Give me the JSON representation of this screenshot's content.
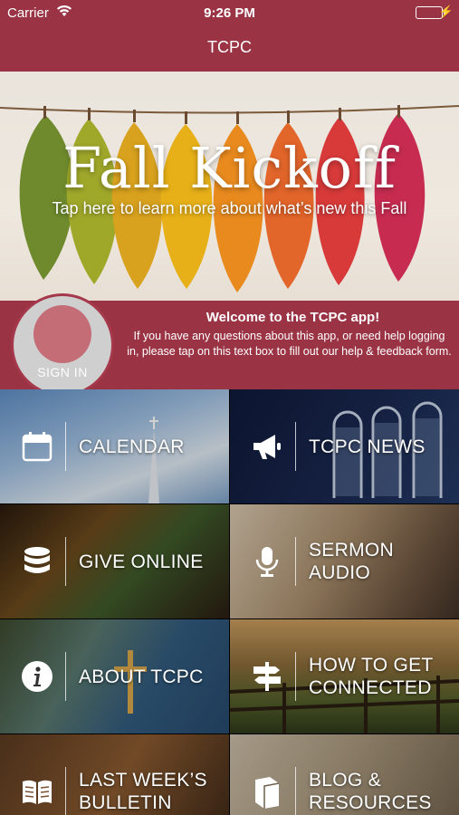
{
  "status_bar": {
    "carrier": "Carrier",
    "time": "9:26 PM"
  },
  "nav": {
    "title": "TCPC"
  },
  "banner": {
    "headline": "Fall Kickoff",
    "subtitle": "Tap here to learn more about what’s new this Fall"
  },
  "welcome": {
    "sign_in": "SIGN IN",
    "title": "Welcome to the TCPC app!",
    "body": "If you have any questions about this app, or need help logging in, please tap on this text box to fill out our help & feedback form."
  },
  "tiles": [
    {
      "label": "CALENDAR",
      "icon": "calendar-icon"
    },
    {
      "label": "TCPC NEWS",
      "icon": "megaphone-icon"
    },
    {
      "label": "GIVE ONLINE",
      "icon": "database-icon"
    },
    {
      "label_line1": "SERMON",
      "label_line2": "AUDIO",
      "icon": "microphone-icon"
    },
    {
      "label": "ABOUT TCPC",
      "icon": "info-icon"
    },
    {
      "label_line1": "HOW TO GET",
      "label_line2": "CONNECTED",
      "icon": "signpost-icon"
    },
    {
      "label_line1": "LAST WEEK’S",
      "label_line2": "BULLETIN",
      "icon": "open-book-icon"
    },
    {
      "label_line1": "BLOG &",
      "label_line2": "RESOURCES",
      "icon": "book-icon"
    }
  ],
  "colors": {
    "brand": "#9a3445",
    "battery": "#5fd35a"
  }
}
